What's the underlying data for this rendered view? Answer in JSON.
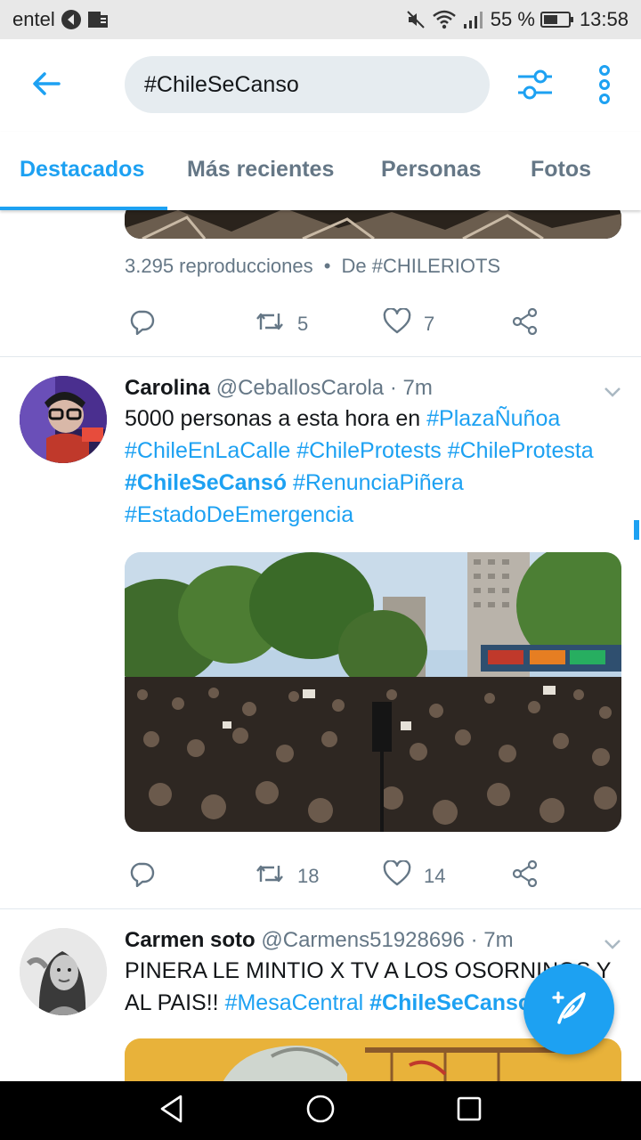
{
  "status_bar": {
    "carrier": "entel",
    "battery_percent": "55 %",
    "time": "13:58"
  },
  "search": {
    "query": "#ChileSeCanso"
  },
  "tabs": [
    {
      "label": "Destacados",
      "active": true
    },
    {
      "label": "Más recientes",
      "active": false
    },
    {
      "label": "Personas",
      "active": false
    },
    {
      "label": "Fotos",
      "active": false
    }
  ],
  "tweet0": {
    "views": "3.295 reproducciones",
    "separator": "•",
    "from_label": "De",
    "source_tag": "#CHILERIOTS",
    "retweets": "5",
    "likes": "7"
  },
  "tweet1": {
    "name": "Carolina",
    "handle": "@CeballosCarola",
    "time": "· 7m",
    "text_plain": "5000 personas a esta hora en",
    "tags": [
      "#PlazaÑuñoa",
      "#ChileEnLaCalle",
      "#ChileProtests",
      "#ChileProtesta",
      "#ChileSeCansó",
      "#RenunciaPiñera",
      "#EstadoDeEmergencia"
    ],
    "retweets": "18",
    "likes": "14"
  },
  "tweet2": {
    "name": "Carmen soto",
    "handle": "@Carmens51928696",
    "time": "· 7m",
    "text_plain_1": "PINERA LE MINTIO X TV A LOS OSORNINOS Y",
    "text_plain_2": "AL PAIS!!",
    "tags": [
      "#MesaCentral",
      "#ChileSeCanso"
    ]
  },
  "colors": {
    "accent": "#1da1f2",
    "secondary_text": "#657786",
    "primary_text": "#14171a"
  }
}
